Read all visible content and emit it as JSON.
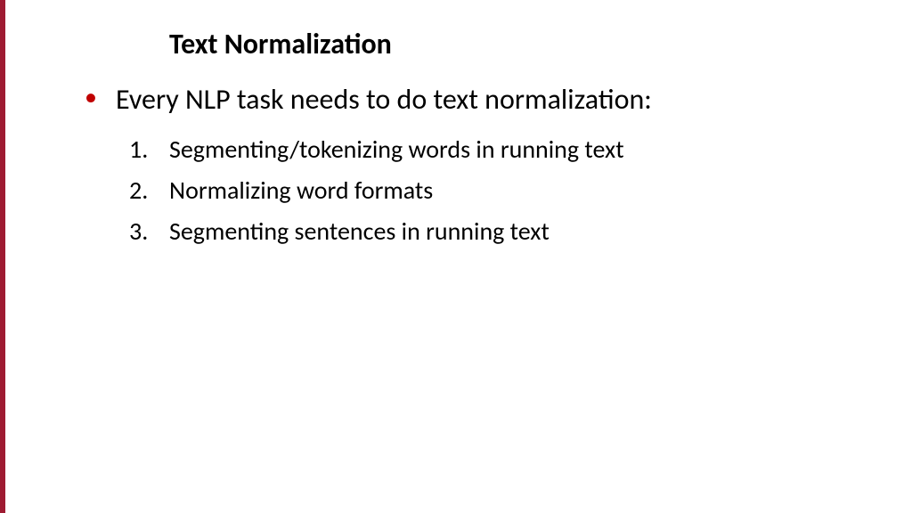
{
  "slide": {
    "title": "Text Normalization",
    "bullet": {
      "text": "Every NLP task needs to do text normalization:"
    },
    "numbered_items": [
      {
        "num": "1.",
        "text": "Segmenting/tokenizing words in running text"
      },
      {
        "num": "2.",
        "text": "Normalizing word formats"
      },
      {
        "num": "3.",
        "text": "Segmenting sentences in running text"
      }
    ]
  }
}
